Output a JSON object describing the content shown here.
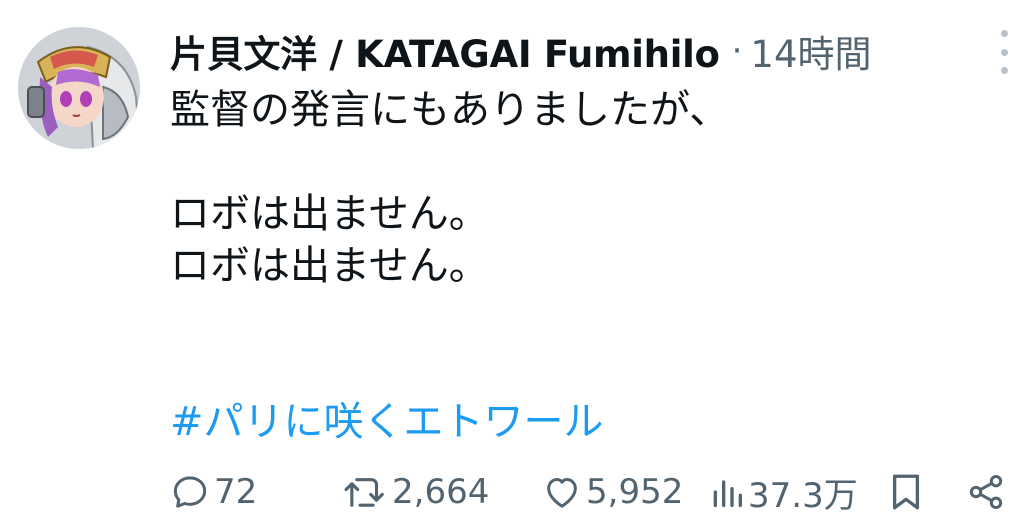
{
  "tweet": {
    "author": {
      "display_name": "片貝文洋 / KATAGAI Fumihilo",
      "separator": "·",
      "time": "14時間"
    },
    "lines": [
      "監督の発言にもありましたが、",
      "",
      "ロボは出ません。",
      "ロボは出ません。",
      "",
      ""
    ],
    "hashtag": "#パリに咲くエトワール",
    "actions": {
      "replies": "72",
      "retweets": "2,664",
      "likes": "5,952",
      "views": "37.3万"
    }
  },
  "icons": [
    "more-vertical-icon",
    "reply-icon",
    "retweet-icon",
    "like-icon",
    "views-icon",
    "bookmark-icon",
    "share-icon"
  ],
  "colors": {
    "text": "#0f1419",
    "muted": "#536471",
    "accent": "#1d9bf0"
  }
}
